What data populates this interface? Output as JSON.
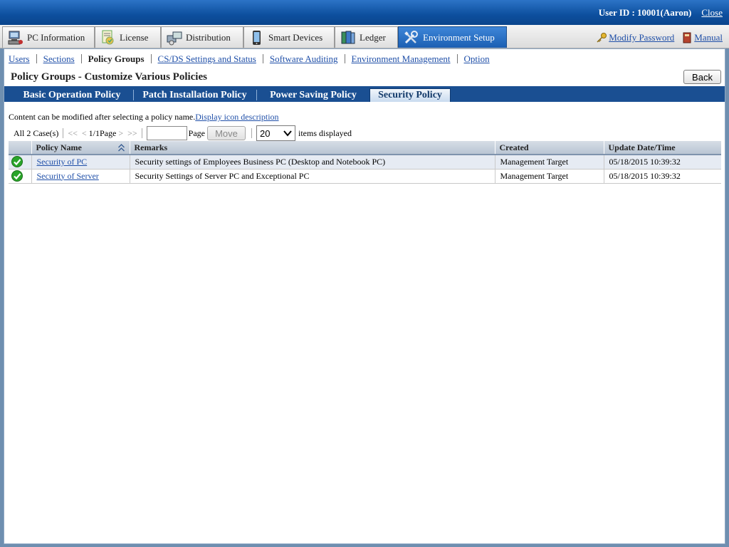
{
  "header": {
    "user_id": "User ID : 10001(Aaron)",
    "close_label": "Close"
  },
  "main_tabs": [
    {
      "label": "PC Information",
      "icon": "pc-icon"
    },
    {
      "label": "License",
      "icon": "license-icon"
    },
    {
      "label": "Distribution",
      "icon": "distribution-icon"
    },
    {
      "label": "Smart Devices",
      "icon": "smart-device-icon"
    },
    {
      "label": "Ledger",
      "icon": "ledger-icon"
    },
    {
      "label": "Environment Setup",
      "icon": "tools-icon",
      "active": true
    }
  ],
  "top_links": {
    "modify_password": "Modify Password",
    "manual": "Manual"
  },
  "subnav": [
    {
      "label": "Users"
    },
    {
      "label": "Sections"
    },
    {
      "label": "Policy Groups",
      "current": true
    },
    {
      "label": "CS/DS Settings and Status"
    },
    {
      "label": "Software Auditing"
    },
    {
      "label": "Environment Management"
    },
    {
      "label": "Option"
    }
  ],
  "page": {
    "title": "Policy Groups - Customize Various Policies",
    "back_label": "Back"
  },
  "policy_tabs": [
    {
      "label": "Basic Operation Policy"
    },
    {
      "label": "Patch Installation Policy"
    },
    {
      "label": "Power Saving Policy"
    },
    {
      "label": "Security Policy",
      "active": true
    }
  ],
  "hint": {
    "text": "Content can be modified after selecting a policy name.",
    "link": "Display icon description"
  },
  "pager": {
    "total": "All 2 Case(s)",
    "first": "<<",
    "prev": "<",
    "page_info": "1/1Page",
    "next": ">",
    "last": ">>",
    "page_input_value": "",
    "page_label": "Page",
    "move_label": "Move",
    "per_page_value": "20",
    "per_page_suffix": "items displayed"
  },
  "table": {
    "columns": [
      "",
      "Policy Name",
      "Remarks",
      "Created",
      "Update Date/Time"
    ],
    "rows": [
      {
        "status_icon": "check-ok-icon",
        "name": "Security of PC",
        "remarks": "Security settings of Employees Business PC (Desktop and Notebook PC)",
        "created": "Management Target",
        "updated": "05/18/2015 10:39:32"
      },
      {
        "status_icon": "check-ok-icon",
        "name": "Security of Server",
        "remarks": "Security Settings of Server PC and Exceptional PC",
        "created": "Management Target",
        "updated": "05/18/2015 10:39:32"
      }
    ]
  },
  "colors": {
    "header_blue": "#0d4f9e",
    "active_tab_blue": "#1b5fb3",
    "policy_tab_bar": "#1a4f92",
    "link": "#1f4fa8",
    "ok_green": "#2aa52a"
  }
}
